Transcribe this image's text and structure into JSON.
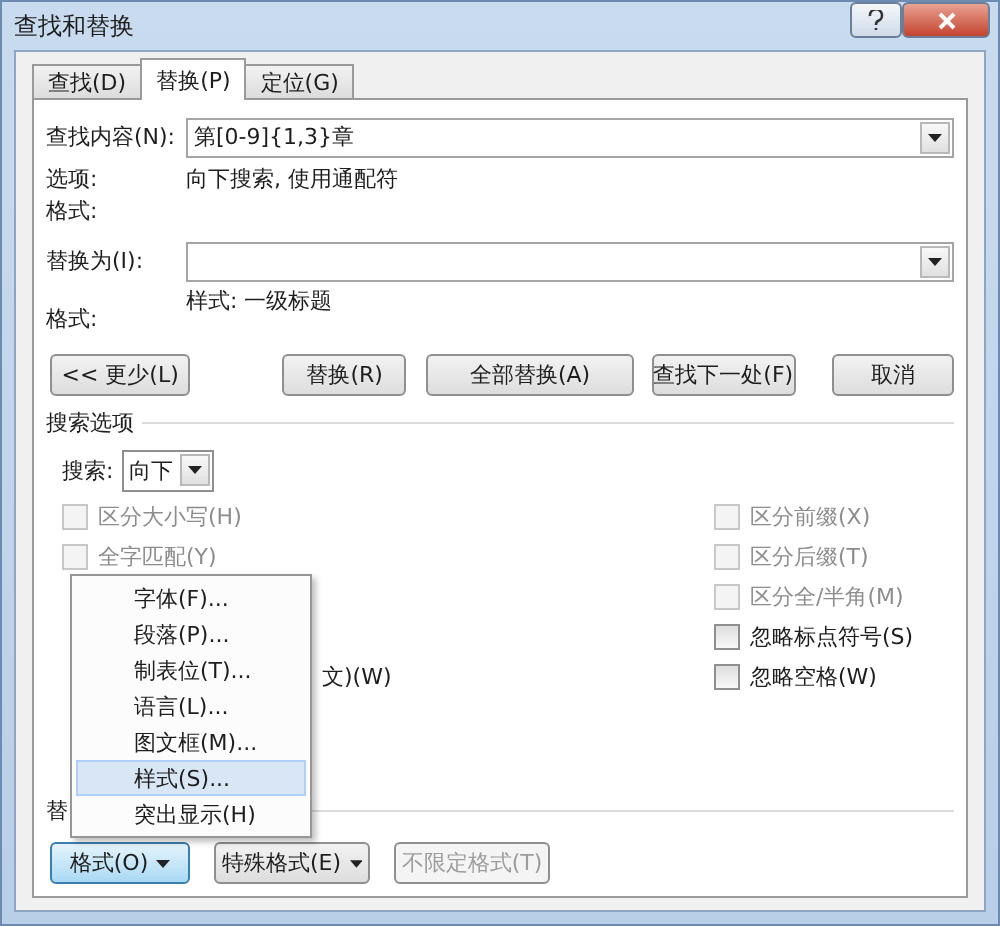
{
  "window": {
    "title": "查找和替换"
  },
  "tabs": [
    {
      "label": "查找(D)",
      "selected": false
    },
    {
      "label": "替换(P)",
      "selected": true
    },
    {
      "label": "定位(G)",
      "selected": false
    }
  ],
  "find": {
    "label": "查找内容(N):",
    "value": "第[0-9]{1,3}章"
  },
  "find_options": {
    "label": "选项:",
    "value": "向下搜索, 使用通配符"
  },
  "find_format": {
    "label": "格式:"
  },
  "replace": {
    "label": "替换为(I):"
  },
  "replace_format": {
    "label": "格式:",
    "value": "样式: 一级标题"
  },
  "buttons": [
    "<< 更少(L)",
    "替换(R)",
    "全部替换(A)",
    "查找下一处(F)",
    "取消"
  ],
  "search_options": {
    "title": "搜索选项",
    "direction_label": "搜索:",
    "direction_value": "向下",
    "left_checkboxes": [
      {
        "label": "区分大小写(H)",
        "checked": false,
        "disabled": true
      },
      {
        "label": "全字匹配(Y)",
        "checked": false,
        "disabled": true
      }
    ],
    "partial_text": "文)(W)",
    "right_checkboxes": [
      {
        "label": "区分前缀(X)",
        "checked": false,
        "disabled": true
      },
      {
        "label": "区分后缀(T)",
        "checked": false,
        "disabled": true
      },
      {
        "label": "区分全/半角(M)",
        "checked": false,
        "disabled": true
      },
      {
        "label": "忽略标点符号(S)",
        "checked": false,
        "disabled": false
      },
      {
        "label": "忽略空格(W)",
        "checked": false,
        "disabled": false
      }
    ]
  },
  "replace_group": {
    "title": "替"
  },
  "bottom_buttons": [
    {
      "label": "格式(O)",
      "caret": true,
      "active": true,
      "disabled": false
    },
    {
      "label": "特殊格式(E)",
      "caret": true,
      "active": false,
      "disabled": false
    },
    {
      "label": "不限定格式(T)",
      "caret": false,
      "active": false,
      "disabled": true
    }
  ],
  "menu": {
    "items": [
      {
        "label": "字体(F)...",
        "selected": false
      },
      {
        "label": "段落(P)...",
        "selected": false
      },
      {
        "label": "制表位(T)...",
        "selected": false
      },
      {
        "label": "语言(L)...",
        "selected": false
      },
      {
        "label": "图文框(M)...",
        "selected": false
      },
      {
        "label": "样式(S)...",
        "selected": true
      },
      {
        "label": "突出显示(H)",
        "selected": false
      }
    ]
  }
}
